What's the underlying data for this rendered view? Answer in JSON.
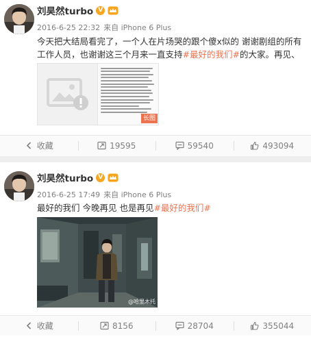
{
  "colors": {
    "hashtag": "#eb7350",
    "meta_text": "#808080",
    "verified_badge": "#f5a623",
    "heart": "#e0262b"
  },
  "posts": [
    {
      "username": "刘昊然turbo",
      "verified_icon": "verified-v-icon",
      "member_icon": "member-crown-icon",
      "timestamp": "2016-6-25 22:32",
      "source": "来自 iPhone 6 Plus",
      "text": "今天把大结局看完了，一个人在片场哭的跟个傻x似的 谢谢剧组的所有工作人员，也谢谢这三个月来一直支持",
      "hashtag": "#最好的我们#",
      "text_after": "的大家。再见、再见",
      "emoji": "❤",
      "image_badge": "长图",
      "actions": {
        "favorite": "收藏",
        "repost": "19595",
        "comment": "59540",
        "like": "493094"
      }
    },
    {
      "username": "刘昊然turbo",
      "verified_icon": "verified-v-icon",
      "member_icon": "member-crown-icon",
      "timestamp": "2016-6-25 17:49",
      "source": "来自 iPhone 6 Plus",
      "text": "最好的我们 今晚再见 也是再见",
      "hashtag": "#最好的我们#",
      "image_watermark": "@哈里木托",
      "actions": {
        "favorite": "收藏",
        "repost": "8156",
        "comment": "28704",
        "like": "355044"
      }
    }
  ]
}
